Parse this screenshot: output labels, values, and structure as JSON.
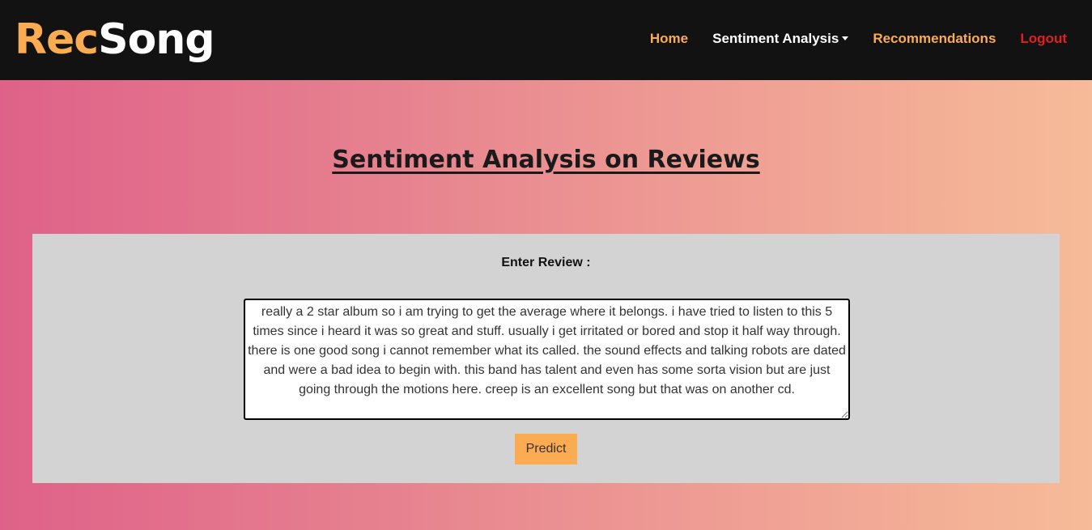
{
  "brand": {
    "part1": "Rec",
    "part2": "Song"
  },
  "nav": {
    "home": "Home",
    "sentiment": "Sentiment Analysis",
    "recommendations": "Recommendations",
    "logout": "Logout"
  },
  "page": {
    "title": "Sentiment Analysis on Reviews"
  },
  "form": {
    "label": "Enter Review :",
    "review_text": "really a 2 star album so i am trying to get the average where it belongs. i have tried to listen to this 5 times since i heard it was so great and stuff. usually i get irritated or bored and stop it half way through. there is one good song i cannot remember what its called. the sound effects and talking robots are dated and were a bad idea to begin with. this band has talent and even has some sorta vision but are just going through the motions here. creep is an excellent song but that was on another cd.",
    "predict_label": "Predict"
  },
  "colors": {
    "navbar_bg": "#121212",
    "accent": "#fbab51",
    "logout": "#e02020",
    "gradient_start": "#df6189",
    "gradient_end": "#f6bb98",
    "panel_bg": "#d3d3d3"
  }
}
